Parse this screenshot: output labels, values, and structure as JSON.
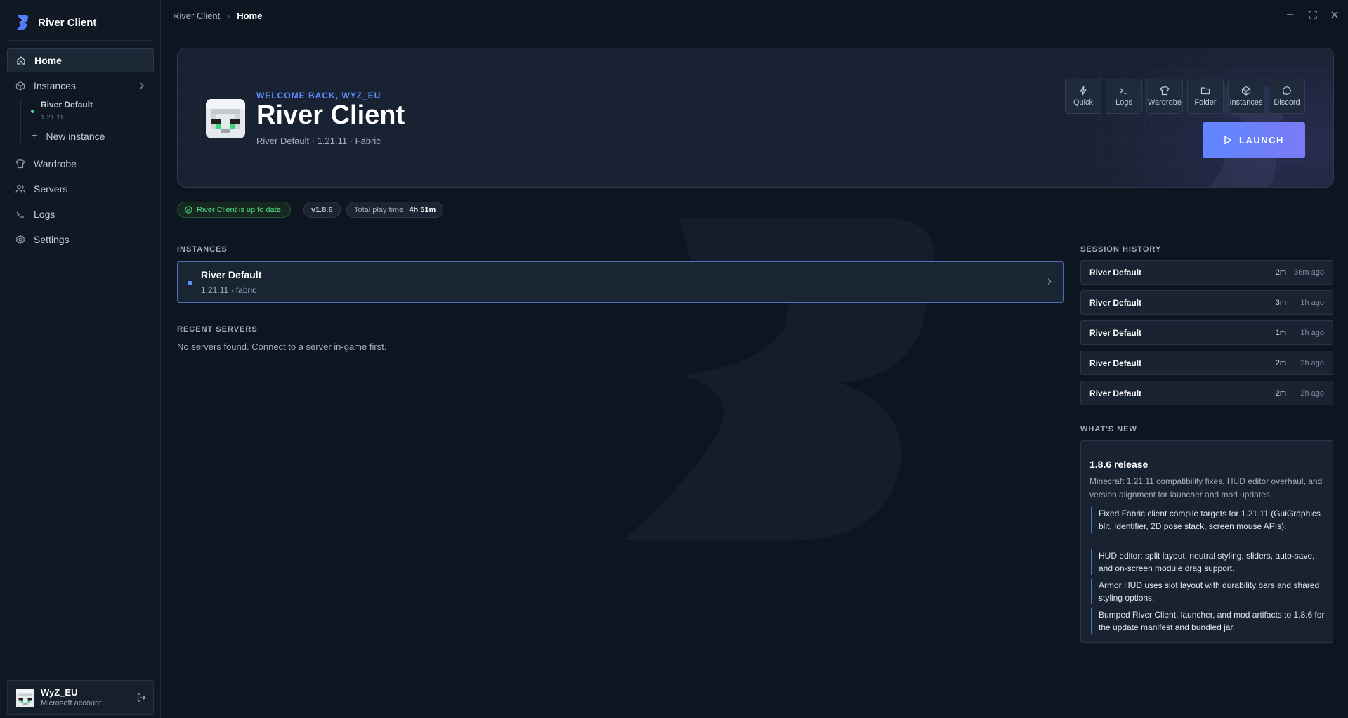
{
  "app": {
    "name": "River Client"
  },
  "sidebar": {
    "nav": {
      "home": "Home",
      "instances": "Instances",
      "wardrobe": "Wardrobe",
      "servers": "Servers",
      "logs": "Logs",
      "settings": "Settings"
    },
    "sub_instance": {
      "name": "River Default",
      "version": "1.21.11"
    },
    "new_instance": "New instance",
    "account": {
      "name": "WyZ_EU",
      "type": "Microsoft account"
    }
  },
  "topbar": {
    "breadcrumb_root": "River Client",
    "breadcrumb_current": "Home"
  },
  "hero": {
    "welcome": "WELCOME BACK, WYZ_EU",
    "title": "River Client",
    "subtitle": "River Default · 1.21.11 · Fabric",
    "quick_actions": [
      "Quick",
      "Logs",
      "Wardrobe",
      "Folder",
      "Instances",
      "Discord"
    ],
    "launch_label": "LAUNCH"
  },
  "status": {
    "update": "River Client is up to date.",
    "version": "v1.8.6",
    "play_time_label": "Total play time",
    "play_time_value": "4h 51m"
  },
  "instances_section": {
    "title": "INSTANCES",
    "items": [
      {
        "name": "River Default",
        "meta": "1.21.11 · fabric"
      }
    ]
  },
  "servers_section": {
    "title": "RECENT SERVERS",
    "empty": "No servers found. Connect to a server in-game first."
  },
  "session_history": {
    "title": "SESSION HISTORY",
    "rows": [
      {
        "name": "River Default",
        "duration": "2m",
        "ago": "36m ago"
      },
      {
        "name": "River Default",
        "duration": "3m",
        "ago": "1h ago"
      },
      {
        "name": "River Default",
        "duration": "1m",
        "ago": "1h ago"
      },
      {
        "name": "River Default",
        "duration": "2m",
        "ago": "2h ago"
      },
      {
        "name": "River Default",
        "duration": "2m",
        "ago": "2h ago"
      }
    ]
  },
  "whats_new": {
    "title": "WHAT'S NEW",
    "release": "1.8.6 release",
    "description": "Minecraft 1.21.11 compatibility fixes, HUD editor overhaul, and version alignment for launcher and mod updates.",
    "bullets": [
      "Fixed Fabric client compile targets for 1.21.11 (GuiGraphics blit, Identifier, 2D pose stack, screen mouse APIs).",
      "HUD editor: split layout, neutral styling, sliders, auto-save, and on-screen module drag support.",
      "Armor HUD uses slot layout with durability bars and shared styling options.",
      "Bumped River Client, launcher, and mod artifacts to 1.8.6 for the update manifest and bundled jar."
    ]
  },
  "colors": {
    "accent": "#5f8cff",
    "success": "#4be08a",
    "background": "#0d1520"
  },
  "icons": [
    "river-logo-icon",
    "home-icon",
    "instances-icon",
    "chevron-right-icon",
    "wardrobe-icon",
    "servers-icon",
    "logs-icon",
    "settings-icon",
    "logout-icon",
    "minimize-icon",
    "maximize-icon",
    "close-icon",
    "quick-icon",
    "folder-icon",
    "discord-icon",
    "play-icon",
    "check-circle-icon"
  ]
}
